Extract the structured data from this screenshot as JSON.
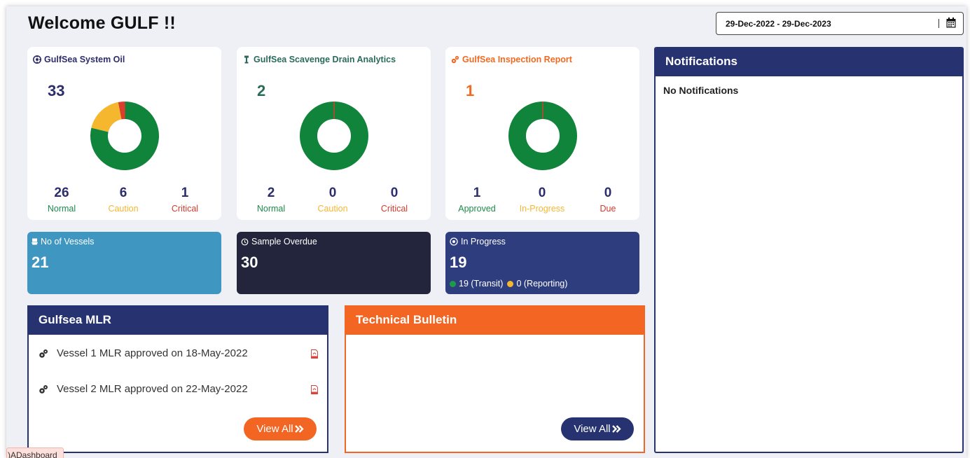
{
  "header": {
    "welcome": "Welcome GULF !!",
    "date_range": "29-Dec-2022 - 29-Dec-2023",
    "calendar_icon": "calendar-icon"
  },
  "cards": [
    {
      "title": "GulfSea System Oil",
      "icon": "oil-icon",
      "count": "33",
      "color": "#2d2d6e",
      "segments": [
        {
          "label": "Normal",
          "value": 26,
          "color": "#11843b"
        },
        {
          "label": "Caution",
          "value": 6,
          "color": "#f5b72e"
        },
        {
          "label": "Critical",
          "value": 1,
          "color": "#d8402c"
        }
      ],
      "stats": [
        {
          "value": "26",
          "label": "Normal"
        },
        {
          "value": "6",
          "label": "Caution"
        },
        {
          "value": "1",
          "label": "Critical"
        }
      ]
    },
    {
      "title": "GulfSea Scavenge Drain Analytics",
      "icon": "drain-icon",
      "count": "2",
      "color": "#2a6b5a",
      "segments": [
        {
          "label": "Normal",
          "value": 2,
          "color": "#11843b"
        },
        {
          "label": "Caution",
          "value": 0,
          "color": "#f5b72e"
        },
        {
          "label": "Critical",
          "value": 0,
          "color": "#d8402c"
        }
      ],
      "stats": [
        {
          "value": "2",
          "label": "Normal"
        },
        {
          "value": "0",
          "label": "Caution"
        },
        {
          "value": "0",
          "label": "Critical"
        }
      ]
    },
    {
      "title": "GulfSea Inspection Report",
      "icon": "gears-icon",
      "count": "1",
      "color": "#f26a22",
      "segments": [
        {
          "label": "Approved",
          "value": 1,
          "color": "#11843b"
        },
        {
          "label": "In-Progress",
          "value": 0,
          "color": "#f5b72e"
        },
        {
          "label": "Due",
          "value": 0,
          "color": "#d8402c"
        }
      ],
      "stats": [
        {
          "value": "1",
          "label": "Approved"
        },
        {
          "value": "0",
          "label": "In-Progress"
        },
        {
          "value": "0",
          "label": "Due"
        }
      ]
    }
  ],
  "tiles": {
    "vessels": {
      "label": "No of Vessels",
      "value": "21",
      "icon": "vessel-icon",
      "color": "#3f97c1"
    },
    "overdue": {
      "label": "Sample Overdue",
      "value": "30",
      "icon": "history-icon",
      "color": "#22253b"
    },
    "inprogress": {
      "label": "In Progress",
      "value": "19",
      "icon": "clock-icon",
      "color": "#2e3d7e",
      "transit": "19 (Transit)",
      "reporting": "0 (Reporting)"
    }
  },
  "mlr": {
    "title": "Gulfsea MLR",
    "items": [
      {
        "text": "Vessel 1 MLR approved on 18-May-2022"
      },
      {
        "text": "Vessel 2 MLR approved on 22-May-2022"
      }
    ],
    "view_all": "View All",
    "header_color": "#273270",
    "button_color": "#f26522"
  },
  "bulletin": {
    "title": "Technical Bulletin",
    "view_all": "View All",
    "header_color": "#f26522",
    "button_color": "#273270"
  },
  "notifications": {
    "title": "Notifications",
    "empty": "No Notifications",
    "header_color": "#273270"
  },
  "footer_tag": ")ADashboard"
}
